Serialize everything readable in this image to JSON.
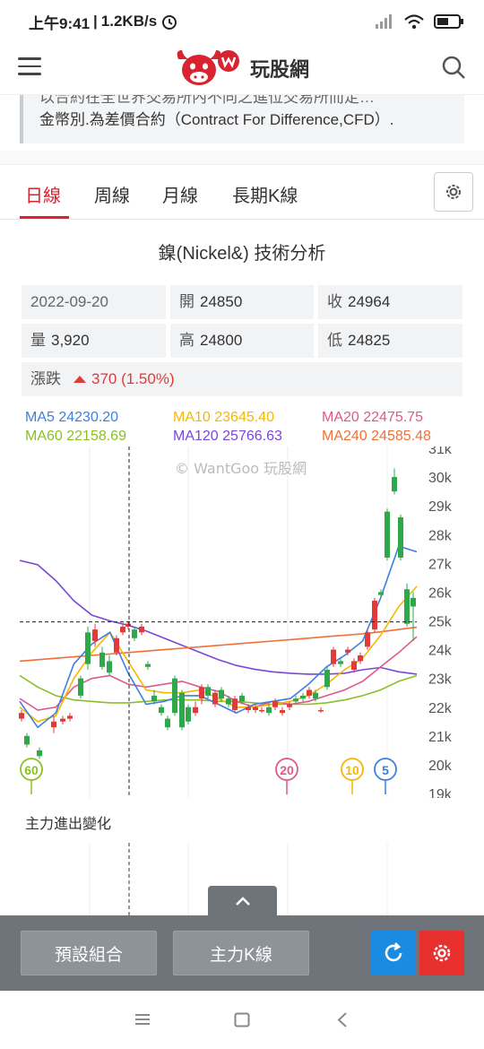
{
  "status_bar": {
    "time": "上午9:41",
    "speed": "1.2KB/s",
    "battery": "battery-icon"
  },
  "header": {
    "brand": "玩股網",
    "menu_icon": "hamburger-menu-icon",
    "search_icon": "search-icon"
  },
  "notice": {
    "partial_line": "以合約在全世界交易所內不同之進位交易所而定…",
    "line": "金幣別.為差價合約（Contract For Difference,CFD）."
  },
  "tabs": [
    "日線",
    "周線",
    "月線",
    "長期K線"
  ],
  "active_tab": 0,
  "page_title": "鎳(Nickel&) 技術分析",
  "quote": {
    "date": "2022-09-20",
    "open_label": "開",
    "open": "24850",
    "close_label": "收",
    "close": "24964",
    "volume_label": "量",
    "volume": "3,920",
    "high_label": "高",
    "high": "24800",
    "low_label": "低",
    "low": "24825",
    "change_label": "漲跌",
    "change": "370 (1.50%)"
  },
  "ma": {
    "ma5": "MA5 24230.20",
    "ma10": "MA10 23645.40",
    "ma20": "MA20 22475.75",
    "ma60": "MA60 22158.69",
    "ma120": "MA120 25766.63",
    "ma240": "MA240 24585.48"
  },
  "colors": {
    "ma5": "#3d7fe0",
    "ma10": "#f5b800",
    "ma20": "#e0588c",
    "ma60": "#8cbf26",
    "ma120": "#7b47d6",
    "ma240": "#f07038",
    "up": "#e03a3a",
    "down": "#2ea84a",
    "accent": "#d9232e"
  },
  "watermark": "© WantGoo 玩股網",
  "chart_data": {
    "type": "candlestick",
    "y_ticks": [
      "31k",
      "30k",
      "29k",
      "28k",
      "27k",
      "26k",
      "25k",
      "24k",
      "23k",
      "22k",
      "21k",
      "20k",
      "19k"
    ],
    "ylim": [
      19000,
      31000
    ],
    "crosshair_price": 24964,
    "ma_markers": [
      "60",
      "20",
      "10",
      "5"
    ]
  },
  "sub_chart_label": "主力進出變化",
  "bottom": {
    "preset_button": "預設組合",
    "main_k_button": "主力K線"
  },
  "nav": {
    "menu": "nav-menu-icon",
    "home": "nav-home-icon",
    "back": "nav-back-icon"
  }
}
